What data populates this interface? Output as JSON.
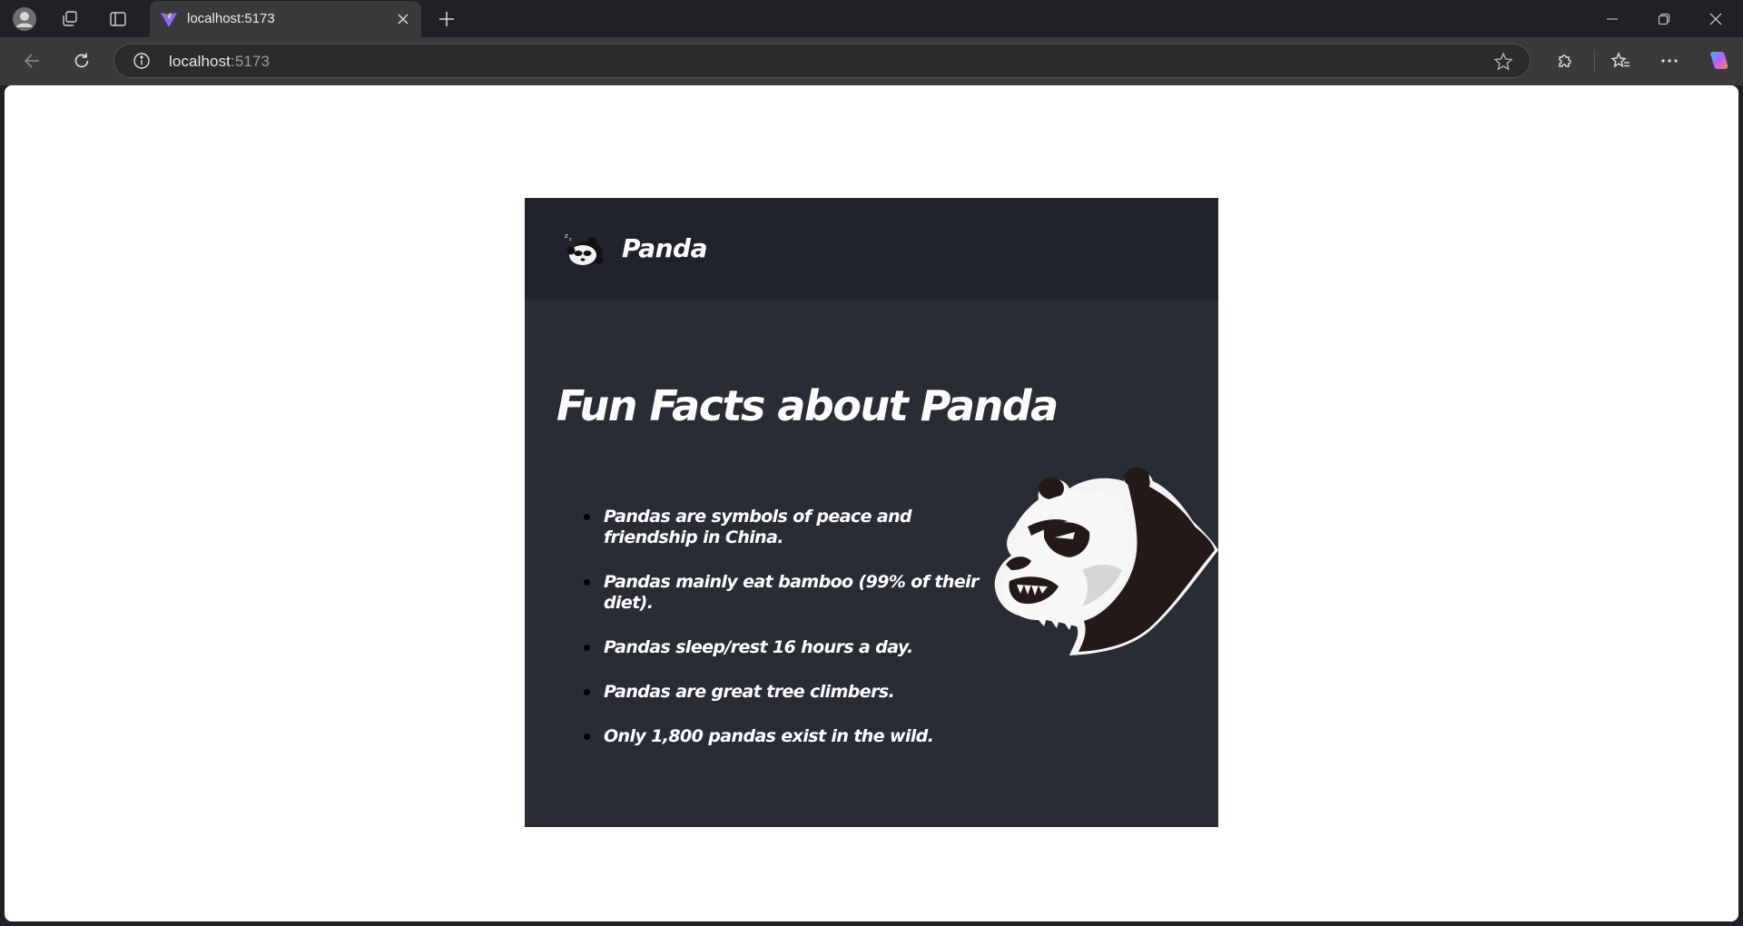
{
  "browser": {
    "tab": {
      "title": "localhost:5173"
    },
    "address": {
      "host": "localhost",
      "port": ":5173"
    }
  },
  "page": {
    "brand": "Panda",
    "heading": "Fun Facts about Panda",
    "facts": [
      "Pandas are symbols of peace and friendship in China.",
      "Pandas mainly eat bamboo (99% of their diet).",
      "Pandas sleep/rest 16 hours a day.",
      "Pandas are great tree climbers.",
      "Only 1,800 pandas exist in the wild."
    ]
  },
  "colors": {
    "header_bg": "#20232a",
    "card_bg": "#282c34",
    "text": "#ffffff"
  },
  "icons": {
    "profile": "profile-icon",
    "workspaces": "workspaces-icon",
    "tab_actions": "tab-actions-icon",
    "favicon": "vite-icon",
    "close": "close-icon",
    "new_tab": "plus-icon",
    "back": "back-arrow-icon",
    "refresh": "refresh-icon",
    "info": "info-icon",
    "favorite": "star-icon",
    "extensions": "puzzle-icon",
    "favorites": "favorites-icon",
    "more": "more-icon",
    "copilot": "copilot-icon"
  }
}
